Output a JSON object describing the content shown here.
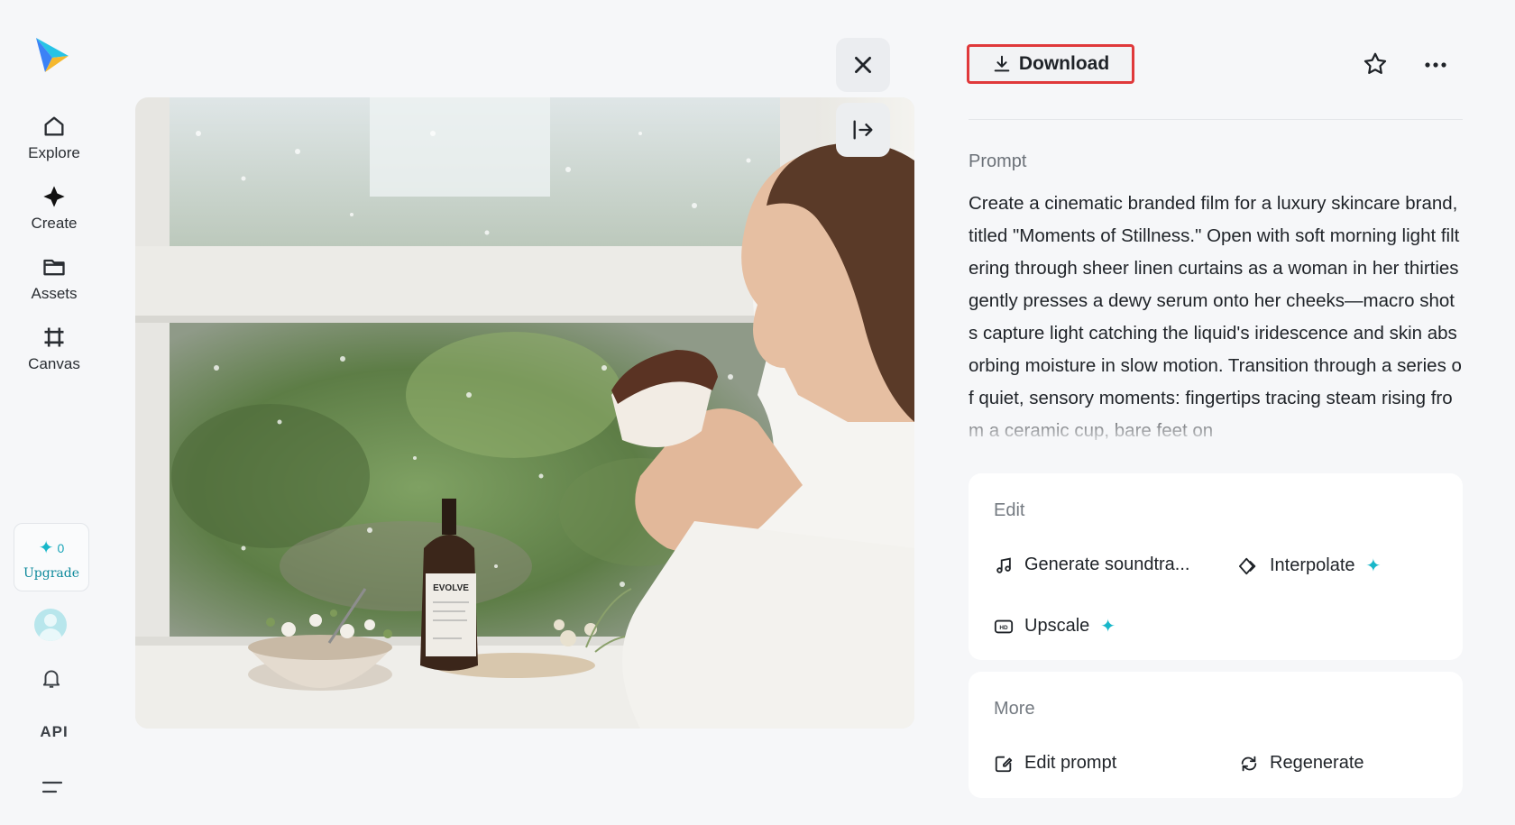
{
  "sidebar": {
    "items": [
      {
        "label": "Explore",
        "icon": "home-icon"
      },
      {
        "label": "Create",
        "icon": "diamond-icon"
      },
      {
        "label": "Assets",
        "icon": "folder-icon"
      },
      {
        "label": "Canvas",
        "icon": "crop-icon"
      }
    ],
    "credits": "0",
    "upgrade_label": "Upgrade",
    "api_label": "API"
  },
  "toolbar": {
    "download_label": "Download"
  },
  "prompt": {
    "title": "Prompt",
    "text": "Create a cinematic branded film for a luxury skincare brand, titled \"Moments of Stillness.\" Open with soft morning light filtering through sheer linen curtains as a woman in her thirties gently presses a dewy serum onto her cheeks—macro shots capture light catching the liquid's iridescence and skin absorbing moisture in slow motion. Transition through a series of quiet, sensory moments: fingertips tracing steam rising from a ceramic cup, bare feet on"
  },
  "edit": {
    "title": "Edit",
    "generate_soundtrack": "Generate soundtra...",
    "interpolate": "Interpolate",
    "upscale": "Upscale"
  },
  "more": {
    "title": "More",
    "edit_prompt": "Edit prompt",
    "regenerate": "Regenerate"
  },
  "photo": {
    "bottle_label": "EVOLVE"
  },
  "colors": {
    "accent": "#18b7c9",
    "download_border": "#e0393b"
  }
}
